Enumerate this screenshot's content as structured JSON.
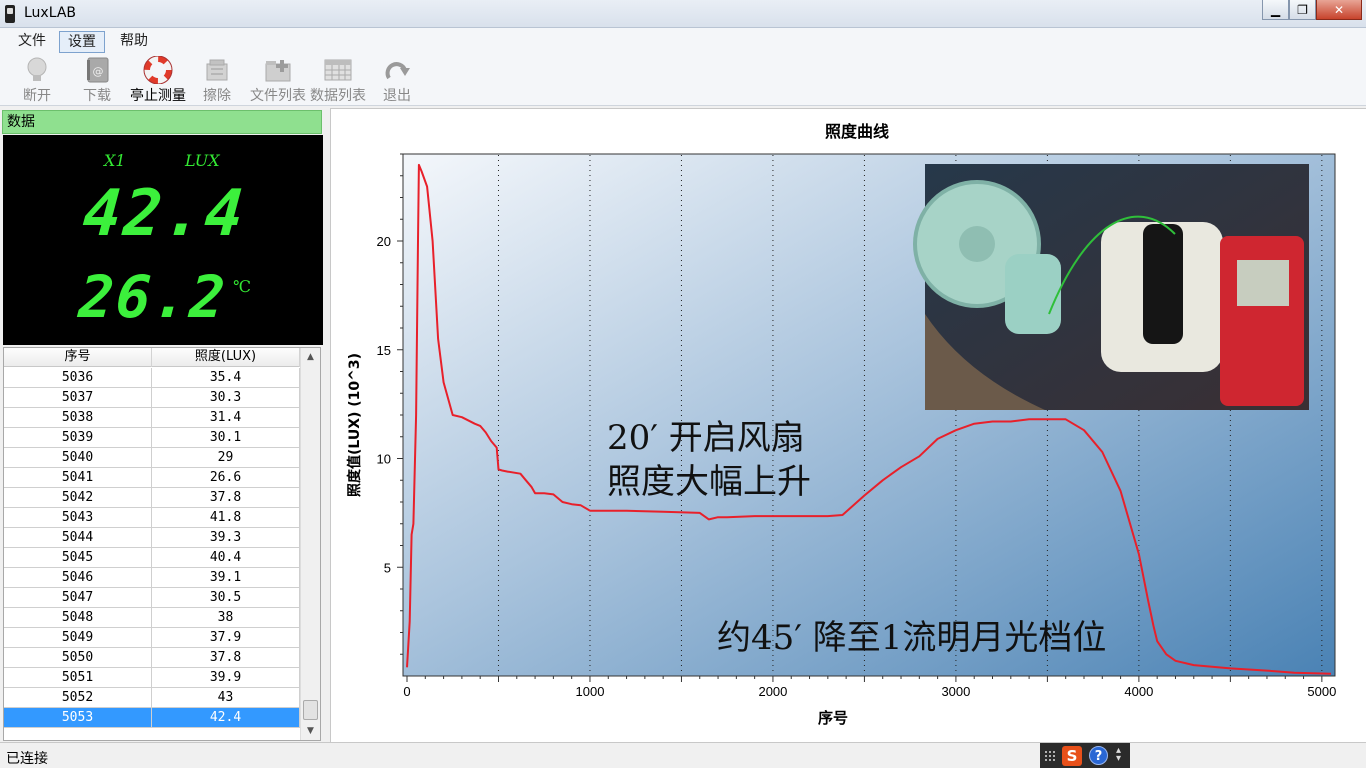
{
  "window": {
    "title": "LuxLAB",
    "controls": [
      "▁",
      "❐",
      "✕"
    ]
  },
  "menu": [
    "文件",
    "设置",
    "帮助"
  ],
  "toolbar": {
    "disconnect": "断开",
    "download": "下载",
    "stop": "亭止测量",
    "erase": "擦除",
    "file_list": "文件列表",
    "data_list": "数据列表",
    "exit": "退出"
  },
  "data_panel": {
    "header": "数据",
    "channel": "X1",
    "unit": "LUX",
    "lux_value": "42.4",
    "temperature": "26.2",
    "temp_unit": "℃"
  },
  "table": {
    "headers": [
      "序号",
      "照度(LUX)"
    ],
    "rows": [
      [
        "5036",
        "35.4"
      ],
      [
        "5037",
        "30.3"
      ],
      [
        "5038",
        "31.4"
      ],
      [
        "5039",
        "30.1"
      ],
      [
        "5040",
        "29"
      ],
      [
        "5041",
        "26.6"
      ],
      [
        "5042",
        "37.8"
      ],
      [
        "5043",
        "41.8"
      ],
      [
        "5044",
        "39.3"
      ],
      [
        "5045",
        "40.4"
      ],
      [
        "5046",
        "39.1"
      ],
      [
        "5047",
        "30.5"
      ],
      [
        "5048",
        "38"
      ],
      [
        "5049",
        "37.9"
      ],
      [
        "5050",
        "37.8"
      ],
      [
        "5051",
        "39.9"
      ],
      [
        "5052",
        "43"
      ],
      [
        "5053",
        "42.4"
      ]
    ],
    "selected_index": 17
  },
  "status": {
    "text": "已连接"
  },
  "tray": {
    "ime": "S",
    "help": "?"
  },
  "colors": {
    "curve": "#e8202a",
    "plot_top_left": "#f4f7fb",
    "plot_bottom_right": "#4a82b4",
    "header_green": "#8fe08f",
    "lcd_green": "#3cf03c",
    "selection": "#3399ff"
  },
  "chart_data": {
    "type": "line",
    "title": "照度曲线",
    "xlabel": "序号",
    "ylabel": "照度值(LUX)  (10^3)",
    "xlim": [
      0,
      5050
    ],
    "ylim": [
      0,
      24
    ],
    "xticks": [
      0,
      1000,
      2000,
      3000,
      4000,
      5000
    ],
    "yticks": [
      5,
      10,
      15,
      20
    ],
    "grid": "vertical-dotted",
    "annotations": [
      "20′ 开启风扇",
      "照度大幅上升",
      "约45′ 降至1流明月光档位"
    ],
    "series": [
      {
        "x": [
          0,
          15,
          25,
          35,
          50,
          60,
          65,
          80,
          110,
          140,
          170,
          200,
          250,
          300,
          370,
          400,
          430,
          460,
          490,
          500,
          520,
          550,
          620,
          650,
          680,
          700,
          750,
          800,
          850,
          900,
          950,
          1000,
          1100,
          1200,
          1400,
          1600,
          1650,
          1700,
          1750,
          1900,
          2100,
          2300,
          2380,
          2500,
          2600,
          2700,
          2800,
          2900,
          3000,
          3100,
          3200,
          3300,
          3400,
          3500,
          3600,
          3700,
          3800,
          3900,
          4000,
          4050,
          4080,
          4100,
          4150,
          4200,
          4300,
          4500,
          4700,
          4850,
          5050
        ],
        "y": [
          0.4,
          2.5,
          6.5,
          7.0,
          12.0,
          20.0,
          23.5,
          23.2,
          22.5,
          20.0,
          15.5,
          13.5,
          12.0,
          11.9,
          11.6,
          11.5,
          11.2,
          10.8,
          10.5,
          9.5,
          9.45,
          9.4,
          9.3,
          9.0,
          8.7,
          8.4,
          8.4,
          8.35,
          8.0,
          7.9,
          7.85,
          7.6,
          7.6,
          7.6,
          7.55,
          7.5,
          7.2,
          7.3,
          7.3,
          7.35,
          7.35,
          7.35,
          7.4,
          8.3,
          9.0,
          9.6,
          10.1,
          10.9,
          11.3,
          11.6,
          11.7,
          11.7,
          11.8,
          11.8,
          11.8,
          11.3,
          10.3,
          8.5,
          5.6,
          3.5,
          2.3,
          1.6,
          1.0,
          0.7,
          0.5,
          0.35,
          0.25,
          0.15,
          0.1
        ]
      }
    ]
  }
}
